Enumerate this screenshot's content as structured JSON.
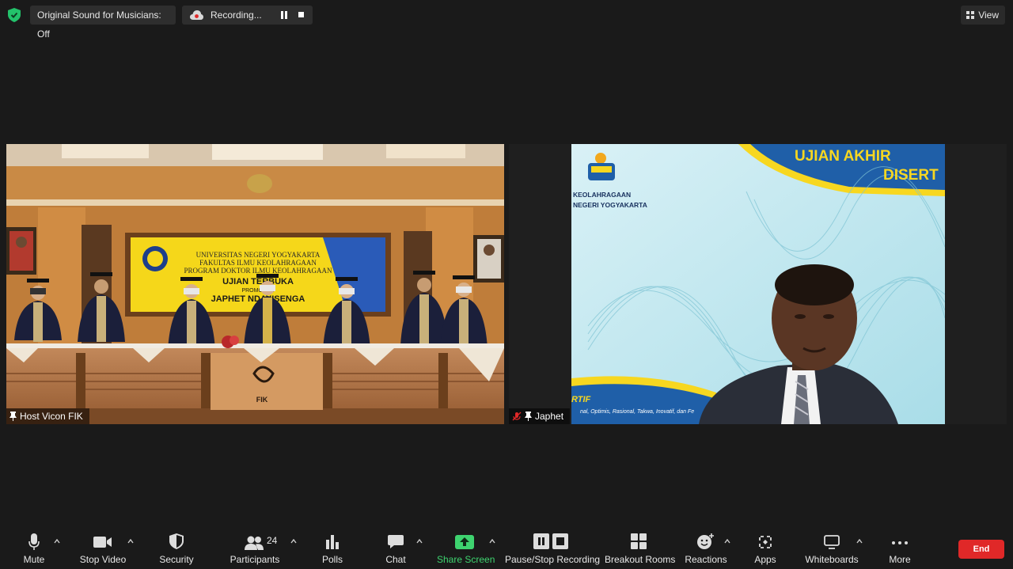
{
  "topbar": {
    "original_sound": "Original Sound for Musicians: Off",
    "recording": "Recording...",
    "view": "View"
  },
  "video": {
    "left": {
      "participant": "Host Vicon FIK",
      "banner": {
        "line1": "UNIVERSITAS NEGERI YOGYAKARTA",
        "line2": "FAKULTAS ILMU KEOLAHRAGAAN",
        "line3": "PROGRAM DOKTOR ILMU KEOLAHRAGAAN",
        "line4": "UJIAN TERBUKA",
        "line5": "PROMOTOR",
        "line6": "JAPHET NDAYISENGA"
      },
      "podium_logo": "FIK"
    },
    "right": {
      "participant": "Japhet",
      "slide_title_1": "UJIAN AKHIR",
      "slide_title_2": "DISERT",
      "slide_org_1": "KEOLAHRAGAAN",
      "slide_org_2": "NEGERI YOGYAKARTA",
      "slide_footer_1": "RTIF",
      "slide_footer_2": "nal, Optimis, Rasional, Takwa, Inovatif, dan Fe"
    }
  },
  "toolbar": {
    "mute": "Mute",
    "stop_video": "Stop Video",
    "security": "Security",
    "participants": "Participants",
    "participants_count": "24",
    "polls": "Polls",
    "chat": "Chat",
    "share_screen": "Share Screen",
    "pause_stop_recording": "Pause/Stop Recording",
    "breakout_rooms": "Breakout Rooms",
    "reactions": "Reactions",
    "apps": "Apps",
    "whiteboards": "Whiteboards",
    "more": "More",
    "end": "End"
  },
  "colors": {
    "accent_green": "#3ed36f",
    "end_red": "#e02828",
    "slide_yellow": "#f7d720",
    "slide_blue": "#1f5fa8"
  }
}
